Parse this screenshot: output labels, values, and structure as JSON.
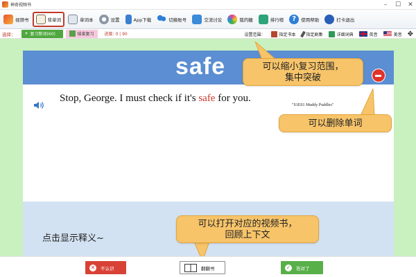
{
  "window": {
    "title": "神奇视频书"
  },
  "toolbar": {
    "items": [
      {
        "label": "视频书"
      },
      {
        "label": "背单词"
      },
      {
        "label": "单词本"
      },
      {
        "label": "设置"
      },
      {
        "label": "App下载"
      },
      {
        "label": "切换账号"
      },
      {
        "label": "交流讨论"
      },
      {
        "label": "我的糖"
      },
      {
        "label": "排行榜"
      },
      {
        "label": "使用帮助"
      },
      {
        "label": "打卡退出"
      }
    ]
  },
  "subbar": {
    "select_label": "选择：",
    "review_new": "复习新词(60)",
    "end_review": "结束复习",
    "progress": "进度: 0 | 90",
    "range_label": "设置范围：",
    "range_items": [
      {
        "label": "指定书本"
      },
      {
        "label": "指定剧集"
      }
    ],
    "dict_label": "详细词典",
    "lang_items": [
      {
        "label": "英音"
      },
      {
        "label": "美音"
      }
    ]
  },
  "card": {
    "word": "safe",
    "sentence_before": "Stop, George.   I must check if it's ",
    "sentence_highlight": "safe",
    "sentence_after": " for you.",
    "episode": "\"S1E01 Muddy Puddles\"",
    "reveal_text": "点击显示释义~"
  },
  "tooltips": {
    "range_line1": "可以缩小复习范围，",
    "range_line2": "集中突破",
    "delete": "可以删除单词",
    "book_line1": "可以打开对应的视频书，",
    "book_line2": "回顾上下文"
  },
  "bottom": {
    "unknown": "不认识",
    "flip_book": "翻翻书",
    "correct": "答对了"
  },
  "colors": {
    "accent_blue": "#5b8ed2",
    "background_green": "#c9f0bf",
    "highlight_red": "#d2352b",
    "tooltip_orange": "#f7c46a"
  }
}
